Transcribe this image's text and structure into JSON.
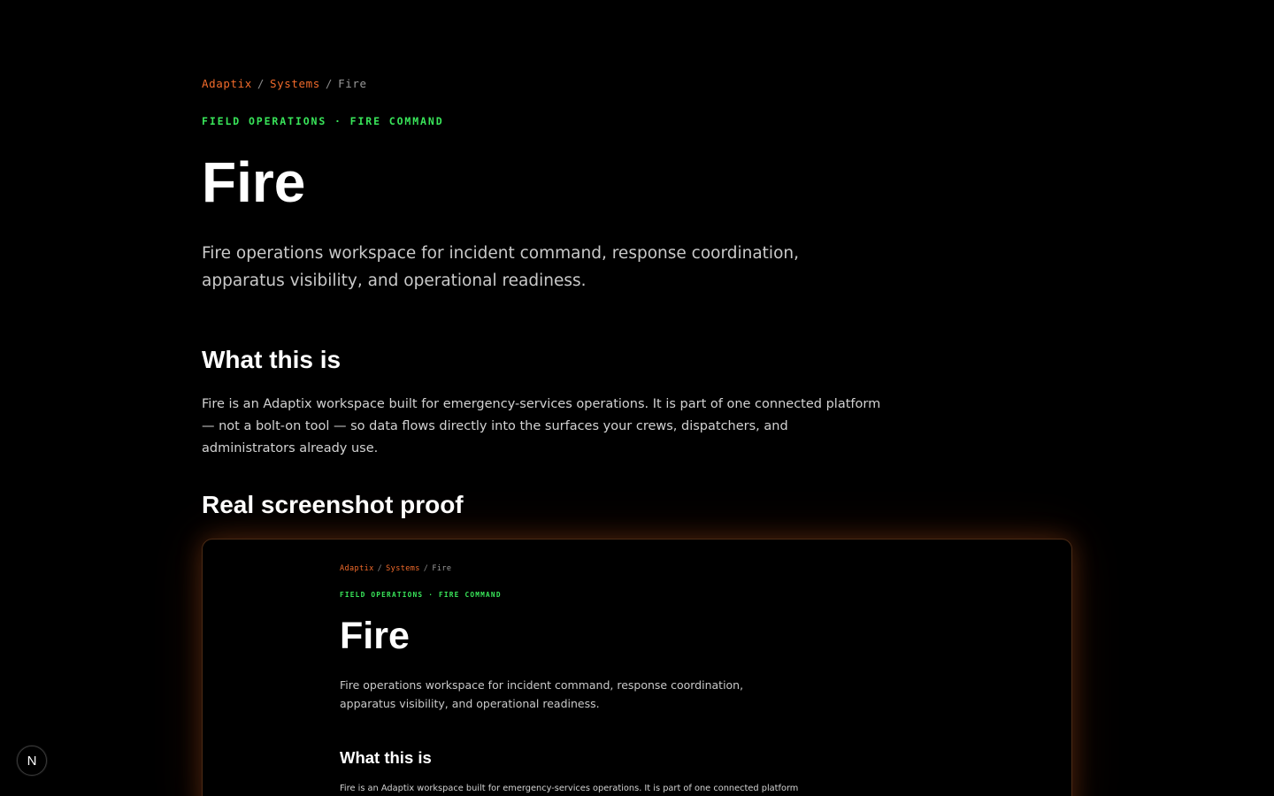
{
  "breadcrumb": {
    "items": [
      "Adaptix",
      "Systems",
      "Fire"
    ],
    "separator": "/"
  },
  "eyebrow": "FIELD OPERATIONS · FIRE COMMAND",
  "title": "Fire",
  "lede": "Fire operations workspace for incident command, response coordination, apparatus visibility, and operational readiness.",
  "sections": {
    "what_heading": "What this is",
    "what_body": "Fire is an Adaptix workspace built for emergency-services operations. It is part of one connected platform — not a bolt-on tool — so data flows directly into the surfaces your crews, dispatchers, and administrators already use.",
    "proof_heading": "Real screenshot proof"
  },
  "screenshot": {
    "breadcrumb": [
      "Adaptix",
      "Systems",
      "Fire"
    ],
    "eyebrow": "FIELD OPERATIONS · FIRE COMMAND",
    "title": "Fire",
    "lede": "Fire operations workspace for incident command, response coordination, apparatus visibility, and operational readiness.",
    "what_heading": "What this is",
    "what_body": "Fire is an Adaptix workspace built for emergency-services operations. It is part of one connected platform — not a"
  },
  "dev_badge": {
    "label": "N",
    "icon": "nextjs-logo-icon"
  },
  "colors": {
    "background": "#000000",
    "accent_orange": "#f26b2b",
    "accent_green": "#39e65a"
  }
}
